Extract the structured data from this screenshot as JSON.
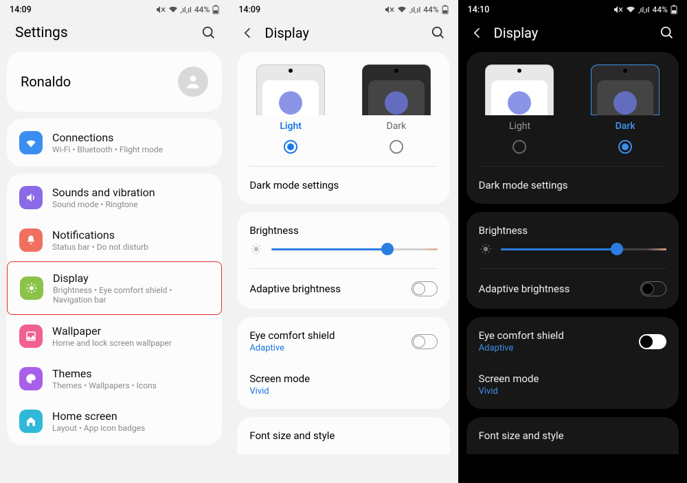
{
  "status_bars": [
    {
      "time": "14:09",
      "battery": "44%"
    },
    {
      "time": "14:09",
      "battery": "44%"
    },
    {
      "time": "14:10",
      "battery": "44%"
    }
  ],
  "screen1": {
    "title": "Settings",
    "profile_name": "Ronaldo",
    "items": [
      {
        "title": "Connections",
        "sub": "Wi-Fi  •  Bluetooth  •  Flight mode"
      },
      {
        "title": "Sounds and vibration",
        "sub": "Sound mode  •  Ringtone"
      },
      {
        "title": "Notifications",
        "sub": "Status bar  •  Do not disturb"
      },
      {
        "title": "Display",
        "sub": "Brightness  •  Eye comfort shield  •  Navigation bar"
      },
      {
        "title": "Wallpaper",
        "sub": "Home and lock screen wallpaper"
      },
      {
        "title": "Themes",
        "sub": "Themes  •  Wallpapers  •  Icons"
      },
      {
        "title": "Home screen",
        "sub": "Layout  •  App icon badges"
      }
    ]
  },
  "display": {
    "title": "Display",
    "light_label": "Light",
    "dark_label": "Dark",
    "dark_mode_settings": "Dark mode settings",
    "brightness": "Brightness",
    "adaptive_brightness": "Adaptive brightness",
    "eye_comfort": "Eye comfort shield",
    "eye_comfort_sub": "Adaptive",
    "screen_mode": "Screen mode",
    "screen_mode_sub": "Vivid",
    "font": "Font size and style",
    "brightness_value_pct": 70
  }
}
